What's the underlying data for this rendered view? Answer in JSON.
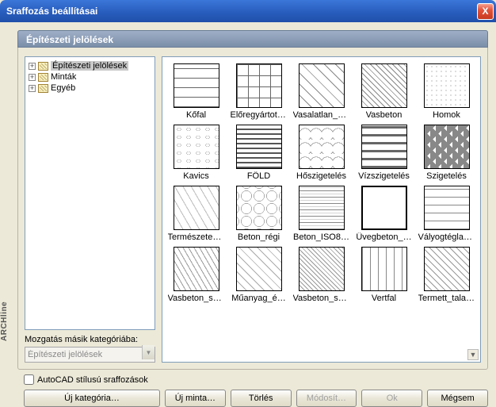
{
  "window": {
    "title": "Sraffozás beállításai",
    "close_label": "X"
  },
  "sidebar_brand": "ARCHline",
  "group": {
    "title": "Építészeti jelölések"
  },
  "tree": {
    "items": [
      {
        "label": "Építészeti jelölések",
        "selected": true
      },
      {
        "label": "Minták",
        "selected": false
      },
      {
        "label": "Egyéb",
        "selected": false
      }
    ]
  },
  "move_cat": {
    "label": "Mozgatás másik kategóriába:",
    "value": "Építészeti jelölések"
  },
  "checkbox": {
    "label": "AutoCAD stílusú sraffozások"
  },
  "patterns": [
    {
      "label": "Kőfal",
      "cls": "p-kofal"
    },
    {
      "label": "Előregyártott…",
      "cls": "p-eloregy"
    },
    {
      "label": "Vasalatlan_b…",
      "cls": "p-vasal"
    },
    {
      "label": "Vasbeton",
      "cls": "p-vasbeton"
    },
    {
      "label": "Homok",
      "cls": "p-homok"
    },
    {
      "label": "Kavics",
      "cls": "p-kavics"
    },
    {
      "label": "FÖLD",
      "cls": "p-fold"
    },
    {
      "label": "Hőszigetelés",
      "cls": "p-hoszig"
    },
    {
      "label": "Vízszigetelés",
      "cls": "p-vizszig"
    },
    {
      "label": "Szigetelés",
      "cls": "p-szig"
    },
    {
      "label": "Természetes…",
      "cls": "p-term"
    },
    {
      "label": "Beton_régi",
      "cls": "p-betonregi"
    },
    {
      "label": "Beton_ISO8…",
      "cls": "p-betoniso"
    },
    {
      "label": "Üvegbeton_…",
      "cls": "p-uvegbeton"
    },
    {
      "label": "Vályogtégla_…",
      "cls": "p-valyog"
    },
    {
      "label": "Vasbeton_sz…",
      "cls": "p-vasbsz"
    },
    {
      "label": "Műanyag_é…",
      "cls": "p-muanyag"
    },
    {
      "label": "Vasbeton_sz…",
      "cls": "p-vasbsz2"
    },
    {
      "label": "Vertfal",
      "cls": "p-vertfal"
    },
    {
      "label": "Termett_talaj…",
      "cls": "p-termett"
    }
  ],
  "buttons": {
    "new_category": "Új kategória…",
    "new_pattern": "Új minta…",
    "delete": "Törlés",
    "modify": "Módosít…",
    "ok": "Ok",
    "cancel": "Mégsem"
  }
}
